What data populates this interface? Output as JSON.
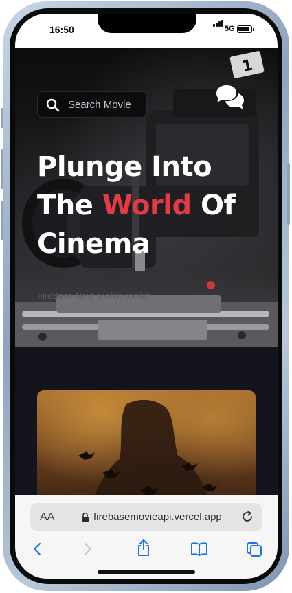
{
  "status_bar": {
    "time": "16:50",
    "network": "5G"
  },
  "hero": {
    "search_placeholder": "Search Movie",
    "title_line1": "Plunge Into",
    "title_line2_prefix": "The ",
    "title_line2_accent": "World",
    "title_line2_suffix": " Of",
    "title_line3": "Cinema",
    "subtitle": "FireBase Next Toolkit Toolkit"
  },
  "browser": {
    "text_size_label": "AA",
    "url": "firebasemovieapi.vercel.app"
  },
  "icons": {
    "search": "search-icon",
    "chat": "chat-bubbles-icon",
    "lock": "lock-icon",
    "reload": "reload-icon",
    "back": "chevron-left-icon",
    "forward": "chevron-right-icon",
    "share": "share-icon",
    "bookmarks": "book-icon",
    "tabs": "tabs-icon"
  },
  "colors": {
    "accent": "#e33a44",
    "page_background": "#14141c",
    "safari_blue": "#1a73e8"
  }
}
